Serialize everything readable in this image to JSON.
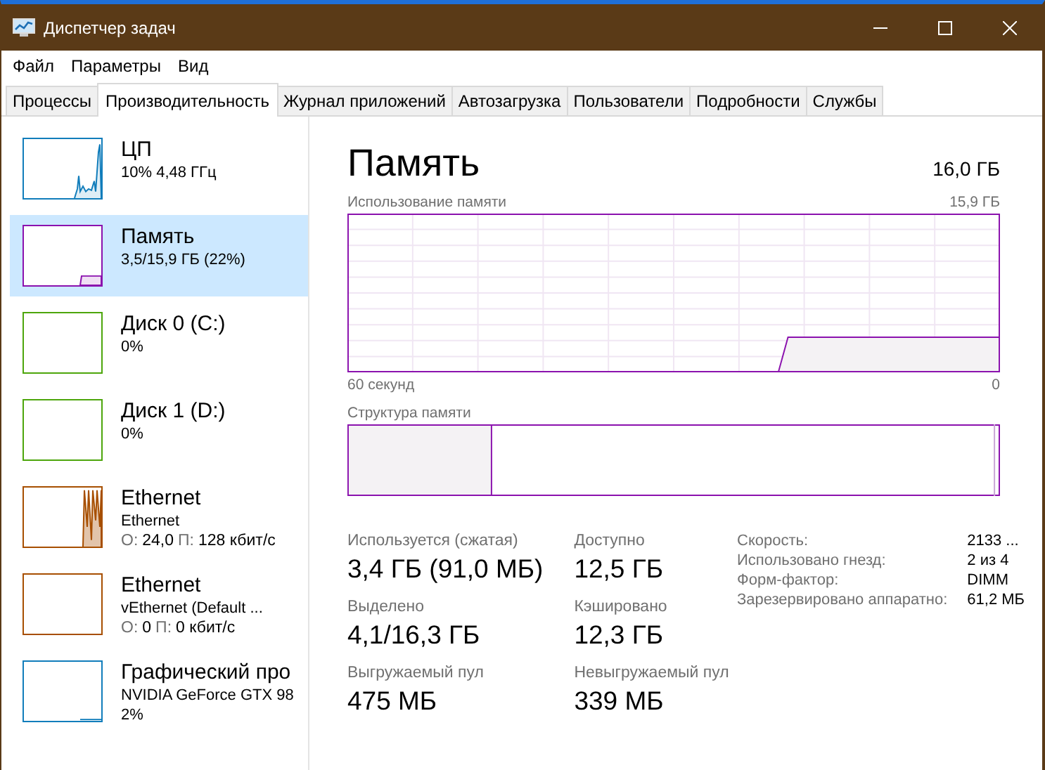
{
  "window": {
    "title": "Диспетчер задач"
  },
  "menu": [
    "Файл",
    "Параметры",
    "Вид"
  ],
  "tabs": [
    {
      "label": "Процессы",
      "selected": false
    },
    {
      "label": "Производительность",
      "selected": true
    },
    {
      "label": "Журнал приложений",
      "selected": false
    },
    {
      "label": "Автозагрузка",
      "selected": false
    },
    {
      "label": "Пользователи",
      "selected": false
    },
    {
      "label": "Подробности",
      "selected": false
    },
    {
      "label": "Службы",
      "selected": false
    }
  ],
  "sidebar": {
    "items": [
      {
        "kind": "cpu",
        "name": "ЦП",
        "lines": [
          "10% 4,48 ГГц"
        ],
        "color": "#117dbb",
        "selected": false
      },
      {
        "kind": "memory",
        "name": "Память",
        "lines": [
          "3,5/15,9 ГБ (22%)"
        ],
        "color": "#8b12ae",
        "selected": true
      },
      {
        "kind": "flat",
        "name": "Диск 0 (C:)",
        "lines": [
          "0%"
        ],
        "color": "#4da60c",
        "selected": false
      },
      {
        "kind": "flat",
        "name": "Диск 1 (D:)",
        "lines": [
          "0%"
        ],
        "color": "#4da60c",
        "selected": false
      },
      {
        "kind": "network",
        "name": "Ethernet",
        "lines": [
          "Ethernet"
        ],
        "stats": [
          {
            "label": "О:",
            "value": "24,0"
          },
          {
            "label": "П:",
            "value": "128 кбит/с"
          }
        ],
        "color": "#a74f01",
        "selected": false
      },
      {
        "kind": "flat",
        "name": "Ethernet",
        "lines": [
          "vEthernet (Default ..."
        ],
        "stats": [
          {
            "label": "О:",
            "value": "0"
          },
          {
            "label": "П:",
            "value": "0 кбит/с"
          }
        ],
        "color": "#a74f01",
        "selected": false
      },
      {
        "kind": "gpu",
        "name": "Графический про",
        "lines": [
          "NVIDIA GeForce GTX 98",
          "2%"
        ],
        "color": "#117dbb",
        "selected": false
      }
    ]
  },
  "main": {
    "title": "Память",
    "total": "16,0 ГБ",
    "usage_graph": {
      "label": "Использование памяти",
      "max": "15,9 ГБ",
      "x_start": "60 секунд",
      "x_end": "0"
    },
    "composition": {
      "label": "Структура памяти"
    },
    "stats": [
      {
        "label": "Используется (сжатая)",
        "value": "3,4 ГБ (91,0 МБ)"
      },
      {
        "label": "Доступно",
        "value": "12,5 ГБ"
      },
      {
        "label": "Выделено",
        "value": "4,1/16,3 ГБ"
      },
      {
        "label": "Кэшировано",
        "value": "12,3 ГБ"
      },
      {
        "label": "Выгружаемый пул",
        "value": "475 МБ"
      },
      {
        "label": "Невыгружаемый пул",
        "value": "339 МБ"
      }
    ],
    "details": [
      {
        "label": "Скорость:",
        "value": "2133 ..."
      },
      {
        "label": "Использовано гнезд:",
        "value": "2 из 4"
      },
      {
        "label": "Форм-фактор:",
        "value": "DIMM"
      },
      {
        "label": "Зарезервировано аппаратно:",
        "value": "61,2 МБ"
      }
    ]
  }
}
